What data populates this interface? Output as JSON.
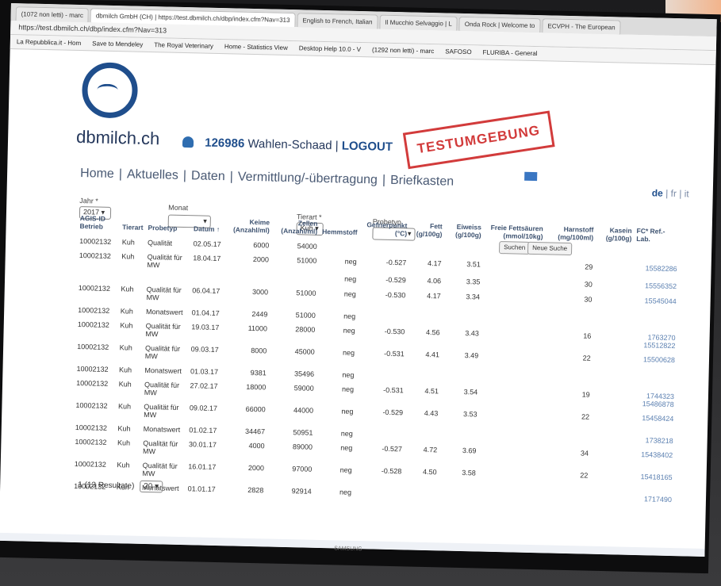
{
  "browser": {
    "tabs": [
      "(1072 non letti) - marc",
      "dbmilch GmbH (CH) | https://test.dbmilch.ch/dbp/index.cfm?Nav=313",
      "English to French, Italian",
      "Il Mucchio Selvaggio | L",
      "Onda Rock | Welcome to",
      "ECVPH - The European"
    ],
    "url": "https://test.dbmilch.ch/dbp/index.cfm?Nav=313",
    "bookmarks": [
      "La Repubblica.it - Hom",
      "Save to Mendeley",
      "The Royal Veterinary",
      "Home - Statistics View",
      "Desktop Help 10.0 - V",
      "(1292 non letti) - marc",
      "SAFOSO",
      "FLURIBA - General"
    ]
  },
  "header": {
    "brand": "dbmilch.ch",
    "user_id": "126986",
    "user_name": "Wahlen-Schaad",
    "logout": "LOGOUT",
    "stamp": "TESTUMGEBUNG",
    "nav": [
      "Home",
      "Aktuelles",
      "Daten",
      "Vermittlung/-übertragung",
      "Briefkasten"
    ],
    "lang": {
      "active": "de",
      "others": "fr | it"
    }
  },
  "filters": {
    "jahr_label": "Jahr *",
    "jahr_value": "2017",
    "monat_label": "Monat",
    "monat_value": "",
    "tierart_label": "Tierart *",
    "tierart_value": "Kuh",
    "probetyp_label": "Probetyp",
    "probetyp_value": "",
    "search_button": "Suchen",
    "new_search_button": "Neue Suche"
  },
  "table": {
    "headers": [
      "AGIS-ID Betrieb",
      "Tierart",
      "Probetyp",
      "Datum ↑",
      "Keime (Anzahl/ml)",
      "Zellen (Anzahl/ml)",
      "Hemmstoff",
      "Gefrierpunkt (°C)",
      "Fett (g/100g)",
      "Eiweiss (g/100g)",
      "Freie Fettsäuren (mmol/10kg)",
      "Harnstoff (mg/100ml)",
      "Kasein (g/100g)",
      "FC* Ref.-Lab."
    ],
    "rows": [
      [
        "10002132",
        "Kuh",
        "Qualität",
        "02.05.17",
        "6000",
        "54000",
        "",
        "",
        "",
        "",
        "",
        "",
        "",
        ""
      ],
      [
        "10002132",
        "Kuh",
        "Qualität für MW",
        "18.04.17",
        "2000",
        "51000",
        "neg",
        "-0.527",
        "4.17",
        "3.51",
        "",
        "29",
        "",
        "15582286"
      ],
      [
        "",
        "",
        "",
        "",
        "",
        "",
        "neg",
        "-0.529",
        "4.06",
        "3.35",
        "",
        "30",
        "",
        "15556352"
      ],
      [
        "10002132",
        "Kuh",
        "Qualität für MW",
        "06.04.17",
        "3000",
        "51000",
        "neg",
        "-0.530",
        "4.17",
        "3.34",
        "",
        "30",
        "",
        "15545044"
      ],
      [
        "10002132",
        "Kuh",
        "Monatswert",
        "01.04.17",
        "2449",
        "51000",
        "neg",
        "",
        "",
        "",
        "",
        "",
        "",
        ""
      ],
      [
        "10002132",
        "Kuh",
        "Qualität für MW",
        "19.03.17",
        "11000",
        "28000",
        "neg",
        "-0.530",
        "4.56",
        "3.43",
        "",
        "16",
        "",
        "1763270 15512822"
      ],
      [
        "10002132",
        "Kuh",
        "Qualität für MW",
        "09.03.17",
        "8000",
        "45000",
        "neg",
        "-0.531",
        "4.41",
        "3.49",
        "",
        "22",
        "",
        "15500628"
      ],
      [
        "10002132",
        "Kuh",
        "Monatswert",
        "01.03.17",
        "9381",
        "35496",
        "neg",
        "",
        "",
        "",
        "",
        "",
        "",
        ""
      ],
      [
        "10002132",
        "Kuh",
        "Qualität für MW",
        "27.02.17",
        "18000",
        "59000",
        "neg",
        "-0.531",
        "4.51",
        "3.54",
        "",
        "19",
        "",
        "1744323 15486878"
      ],
      [
        "10002132",
        "Kuh",
        "Qualität für MW",
        "09.02.17",
        "66000",
        "44000",
        "neg",
        "-0.529",
        "4.43",
        "3.53",
        "",
        "22",
        "",
        "15458424"
      ],
      [
        "10002132",
        "Kuh",
        "Monatswert",
        "01.02.17",
        "34467",
        "50951",
        "neg",
        "",
        "",
        "",
        "",
        "",
        "",
        "1738218"
      ],
      [
        "10002132",
        "Kuh",
        "Qualität für MW",
        "30.01.17",
        "4000",
        "89000",
        "neg",
        "-0.527",
        "4.72",
        "3.69",
        "",
        "34",
        "",
        "15438402"
      ],
      [
        "10002132",
        "Kuh",
        "Qualität für MW",
        "16.01.17",
        "2000",
        "97000",
        "neg",
        "-0.528",
        "4.50",
        "3.58",
        "",
        "22",
        "",
        "15418165"
      ],
      [
        "10002132",
        "Kuh",
        "Monatswert",
        "01.01.17",
        "2828",
        "92914",
        "neg",
        "",
        "",
        "",
        "",
        "",
        "",
        "1717490"
      ]
    ]
  },
  "pager": {
    "page": "1",
    "results": "(13 Resultate)",
    "per_page": "20"
  },
  "bezel": {
    "brand": "SAMSUNG"
  },
  "surroundings": {
    "big_letters": "ch"
  }
}
